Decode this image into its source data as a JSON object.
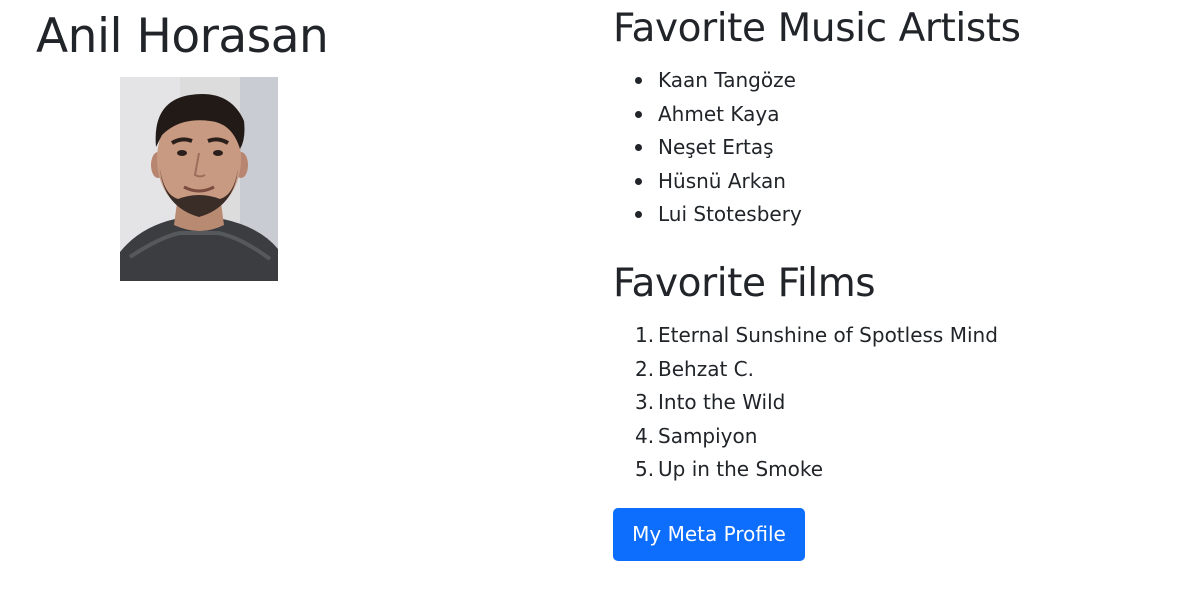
{
  "profile": {
    "name": "Anil Horasan",
    "photo_alt": "Anil Horasan"
  },
  "music": {
    "heading": "Favorite Music Artists",
    "items": [
      "Kaan Tangöze",
      "Ahmet Kaya",
      "Neşet Ertaş",
      "Hüsnü Arkan",
      "Lui Stotesbery"
    ]
  },
  "films": {
    "heading": "Favorite Films",
    "items": [
      {
        "num": "1.",
        "title": "Eternal Sunshine of Spotless Mind"
      },
      {
        "num": "2.",
        "title": "Behzat C."
      },
      {
        "num": "3.",
        "title": "Into the Wild"
      },
      {
        "num": "4.",
        "title": "Sampiyon"
      },
      {
        "num": "5.",
        "title": "Up in the Smoke"
      }
    ]
  },
  "actions": {
    "meta_button_label": "My Meta Profile"
  },
  "colors": {
    "text": "#212529",
    "button": "#0d6efd",
    "button_text": "#ffffff"
  }
}
